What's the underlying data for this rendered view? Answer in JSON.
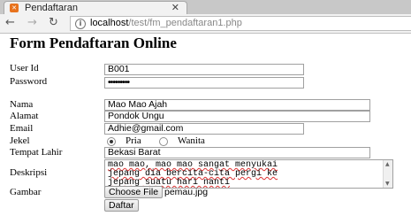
{
  "browser": {
    "tab_title": "Pendaftaran",
    "tab_icon": "xampp-icon",
    "close_glyph": "✕",
    "back_glyph": "←",
    "forward_glyph": "→",
    "reload_glyph": "↻",
    "info_glyph": "i",
    "url_host": "localhost",
    "url_path": "/test/fm_pendaftaran1.php"
  },
  "page": {
    "title": "Form Pendaftaran Online"
  },
  "form": {
    "user_id": {
      "label": "User Id",
      "value": "B001"
    },
    "password": {
      "label": "Password",
      "value": "•••••••••"
    },
    "nama": {
      "label": "Nama",
      "value": "Mao Mao Ajah"
    },
    "alamat": {
      "label": "Alamat",
      "value": "Pondok Ungu"
    },
    "email": {
      "label": "Email",
      "value": "Adhie@gmail.com"
    },
    "jekel": {
      "label": "Jekel",
      "options": [
        "Pria",
        "Wanita"
      ],
      "selected": "Pria"
    },
    "tempat_lahir": {
      "label": "Tempat Lahir",
      "value": "Bekasi Barat"
    },
    "deskripsi": {
      "label": "Deskripsi",
      "lines": [
        "mao mao, mao mao sangat menyukai",
        "jepang dia bercita-cita pergi ke",
        "jepang suatu hari nanti"
      ]
    },
    "gambar": {
      "label": "Gambar",
      "button_label": "Choose File",
      "file_name": "pemau.jpg"
    },
    "submit_label": "Daftar"
  }
}
